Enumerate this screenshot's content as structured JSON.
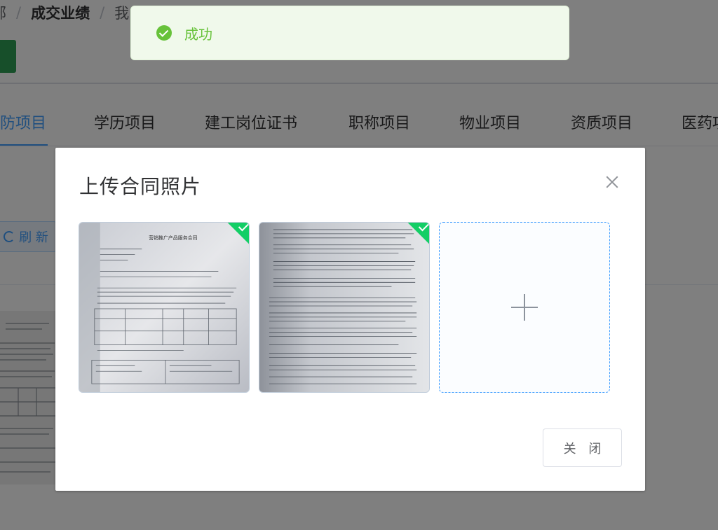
{
  "breadcrumb": {
    "prev_fragment": "部",
    "current": "成交业绩",
    "next_fragment": "我"
  },
  "tabs": [
    {
      "label": "消防项目",
      "active": true
    },
    {
      "label": "学历项目"
    },
    {
      "label": "建工岗位证书"
    },
    {
      "label": "职称项目"
    },
    {
      "label": "物业项目"
    },
    {
      "label": "资质项目"
    },
    {
      "label": "医药项目"
    }
  ],
  "toolbar": {
    "refresh_label": "刷 新",
    "refresh_icon": "refresh-icon"
  },
  "toast": {
    "type": "success",
    "icon": "check-circle-icon",
    "message": "成功",
    "color": "#67c23a"
  },
  "dialog": {
    "title": "上传合同照片",
    "close_icon": "close-icon",
    "uploaded_files": [
      {
        "status": "success",
        "icon": "check-icon",
        "heading": "营销推广产品服务合同"
      },
      {
        "status": "success",
        "icon": "check-icon",
        "heading": ""
      }
    ],
    "upload_trigger_icon": "plus-icon",
    "close_button_label": "关 闭"
  },
  "colors": {
    "primary": "#409eff",
    "success": "#13ce66",
    "toast_bg": "#f0f9eb"
  }
}
